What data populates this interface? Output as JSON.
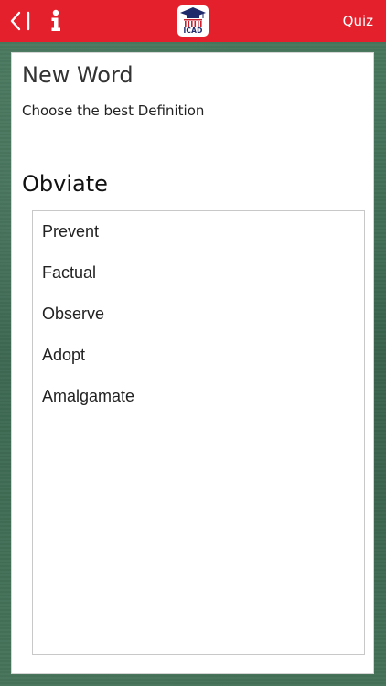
{
  "header": {
    "logo_text": "ICAD",
    "quiz_label": "Quiz",
    "icons": {
      "back": "back-chevron-icon",
      "info": "info-icon",
      "logo": "graduation-cap-logo"
    },
    "bar_color": "#e3202c"
  },
  "card": {
    "title": "New Word",
    "subtitle": "Choose the best Definition",
    "word": "Obviate",
    "options": [
      "Prevent",
      "Factual",
      "Observe",
      "Adopt",
      "Amalgamate"
    ]
  }
}
